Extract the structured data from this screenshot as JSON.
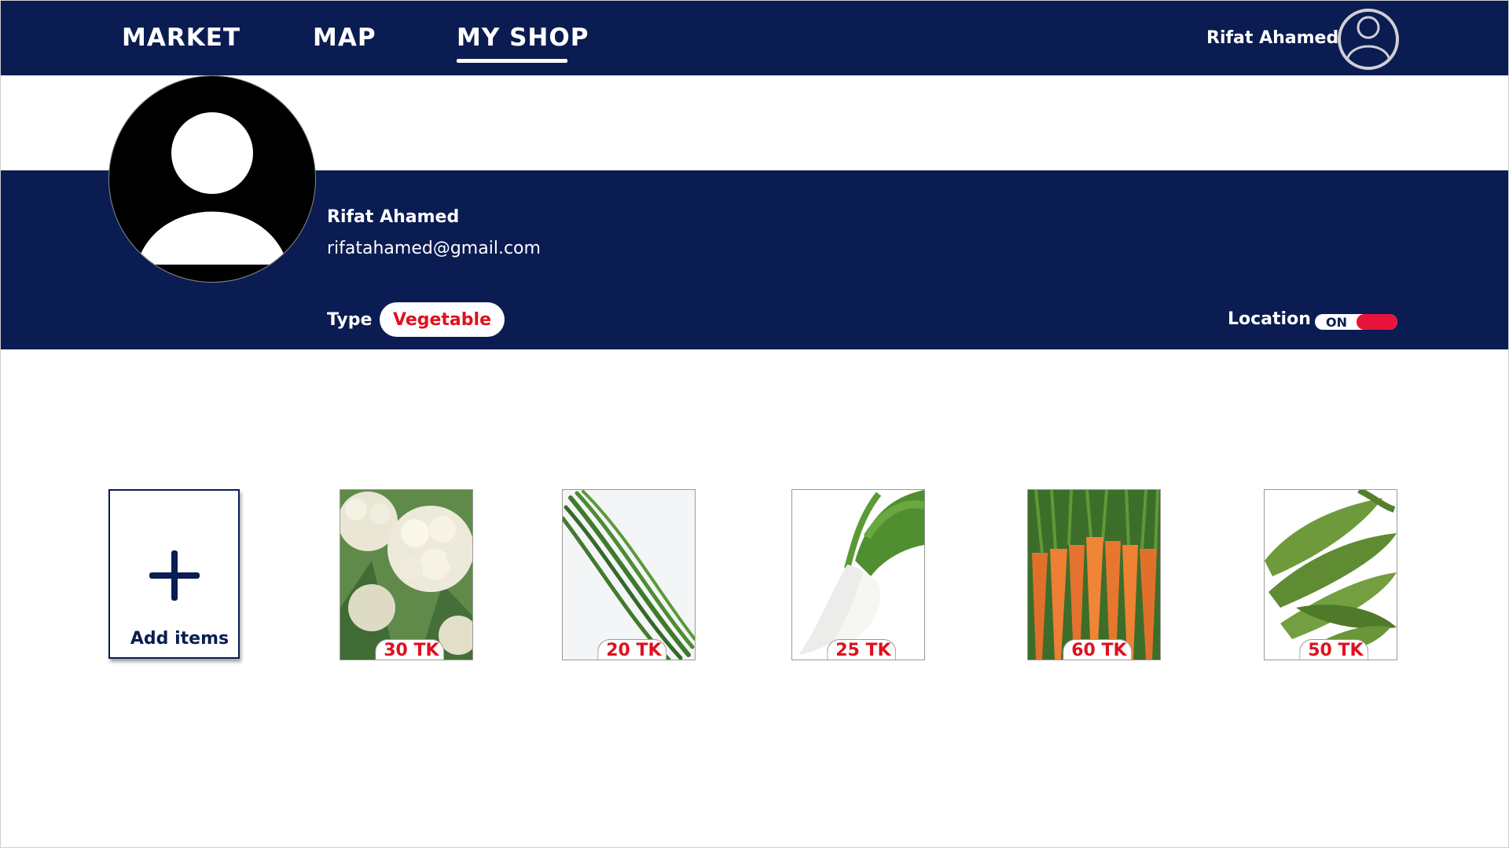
{
  "nav": {
    "market": "MARKET",
    "map": "MAP",
    "my_shop": "MY SHOP",
    "active": "MY SHOP",
    "user_name": "Rifat Ahamed"
  },
  "profile": {
    "name": "Rifat Ahamed",
    "email": "rifatahamed@gmail.com",
    "type_label": "Type",
    "type_value": "Vegetable",
    "location_label": "Location",
    "location_state": "ON"
  },
  "add_items_label": "Add items",
  "items": [
    {
      "image": "cauliflower",
      "price": "30 TK"
    },
    {
      "image": "green beans",
      "price": "20 TK"
    },
    {
      "image": "radish",
      "price": "25 TK"
    },
    {
      "image": "carrots",
      "price": "60 TK"
    },
    {
      "image": "okra",
      "price": "50 TK"
    }
  ],
  "colors": {
    "navy": "#0b1c52",
    "price_red": "#e0101e",
    "toggle_red": "#e8133a"
  }
}
